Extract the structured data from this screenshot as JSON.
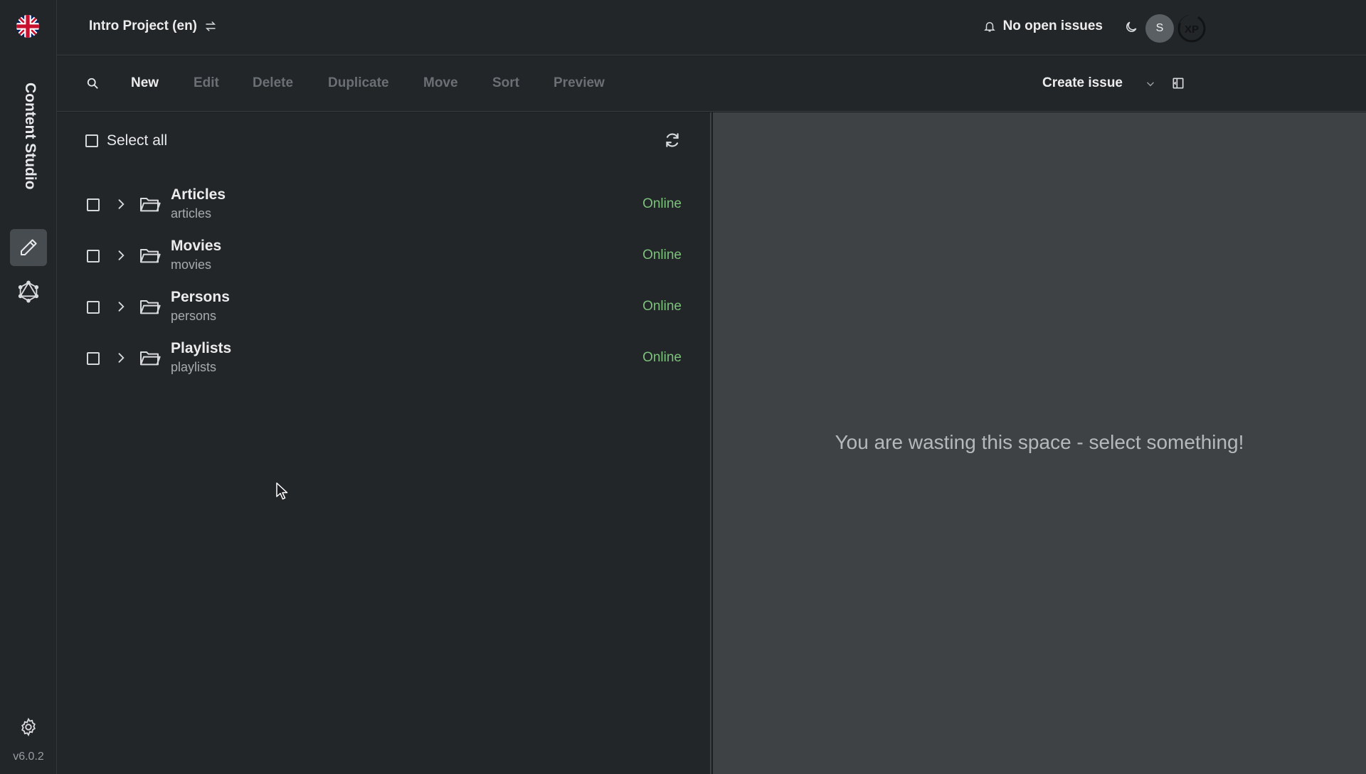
{
  "app": {
    "title": "Content Studio",
    "version": "v6.0.2"
  },
  "topbar": {
    "project": "Intro Project (en)",
    "issues": "No open issues",
    "avatar_initial": "S",
    "logo": "XP"
  },
  "toolbar": {
    "new": "New",
    "edit": "Edit",
    "delete": "Delete",
    "duplicate": "Duplicate",
    "move": "Move",
    "sort": "Sort",
    "preview": "Preview",
    "create_issue": "Create issue"
  },
  "grid": {
    "select_all": "Select all",
    "items": [
      {
        "name": "Articles",
        "path": "articles",
        "status": "Online"
      },
      {
        "name": "Movies",
        "path": "movies",
        "status": "Online"
      },
      {
        "name": "Persons",
        "path": "persons",
        "status": "Online"
      },
      {
        "name": "Playlists",
        "path": "playlists",
        "status": "Online"
      }
    ]
  },
  "preview": {
    "empty_message": "You are wasting this space - select something!"
  },
  "colors": {
    "status_online": "#7bc27a",
    "rail_active": "#474c51",
    "preview_bg": "#3e4244"
  }
}
